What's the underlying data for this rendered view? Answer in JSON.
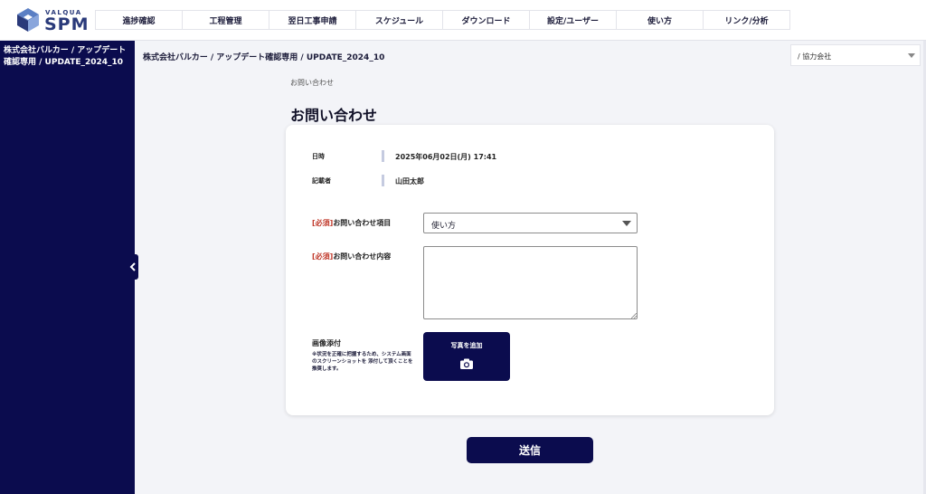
{
  "logo": {
    "brand_small": "VALQUA",
    "brand_big": "SPM"
  },
  "nav": [
    "進捗確認",
    "工程管理",
    "翌日工事申請",
    "スケジュール",
    "ダウンロード",
    "設定/ユーザー",
    "使い方",
    "リンク/分析"
  ],
  "sidebar": {
    "project_title": "株式会社バルカー / アップデート確認専用 / UPDATE_2024_10"
  },
  "topbar": {
    "project_breadcrumb": "株式会社バルカー / アップデート確認専用 / UPDATE_2024_10",
    "company_select_value": "/ 協力会社"
  },
  "page": {
    "breadcrumb": "お問い合わせ",
    "title": "お問い合わせ"
  },
  "form": {
    "datetime_label": "日時",
    "datetime_value": "2025年06月02日(月) 17:41",
    "author_label": "記載者",
    "author_value": "山田太郎",
    "required_tag": "[必須]",
    "category_label": "お問い合わせ項目",
    "category_value": "使い方",
    "content_label": "お問い合わせ内容",
    "content_value": "",
    "attach_label": "画像添付",
    "attach_note": "※状況を正確に把握するため、システム画面のスクリーンショットを 添付して頂くことを推奨します。",
    "add_photo_label": "写真を追加",
    "submit_label": "送信"
  },
  "colors": {
    "navy": "#0b0c4e",
    "required": "#c0392b",
    "background": "#f3f4f8"
  }
}
